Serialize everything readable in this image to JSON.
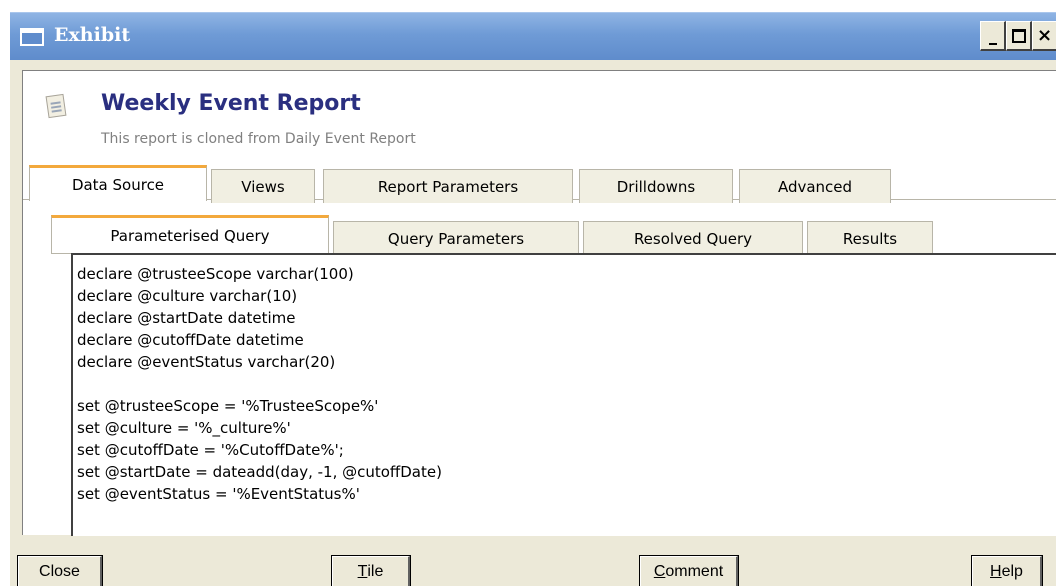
{
  "window": {
    "title": "Exhibit",
    "minimize_icon": "minimize-icon",
    "maximize_icon": "maximize-icon",
    "close_label": "×"
  },
  "report": {
    "title": "Weekly Event Report",
    "subtitle": "This report is cloned from Daily Event Report",
    "icon": "report-icon"
  },
  "main_tabs": [
    {
      "label": "Data Source",
      "active": true
    },
    {
      "label": "Views"
    },
    {
      "label": "Report Parameters"
    },
    {
      "label": "Drilldowns"
    },
    {
      "label": "Advanced"
    }
  ],
  "sub_tabs": [
    {
      "label": "Parameterised Query",
      "active": true
    },
    {
      "label": "Query Parameters"
    },
    {
      "label": "Resolved Query"
    },
    {
      "label": "Results"
    }
  ],
  "query_lines": [
    "declare @trusteeScope varchar(100)",
    "declare @culture varchar(10)",
    "declare @startDate datetime",
    "declare @cutoffDate datetime",
    "declare @eventStatus varchar(20)",
    "",
    "set @trusteeScope = '%TrusteeScope%'",
    "set @culture = '%_culture%'",
    "set @cutoffDate = '%CutoffDate%';",
    "set @startDate = dateadd(day, -1, @cutoffDate)",
    "set @eventStatus = '%EventStatus%'"
  ],
  "buttons": {
    "close": {
      "first": "",
      "mnemonic": "",
      "rest": "Close"
    },
    "tile": {
      "first": "",
      "mnemonic": "T",
      "rest": "ile"
    },
    "comment": {
      "first": "",
      "mnemonic": "C",
      "rest": "omment"
    },
    "help": {
      "first": "",
      "mnemonic": "H",
      "rest": "elp"
    }
  },
  "colors": {
    "titlebar": "#6f9bd6",
    "report_title": "#2a2f80",
    "active_tab_accent": "#f3a93c"
  }
}
